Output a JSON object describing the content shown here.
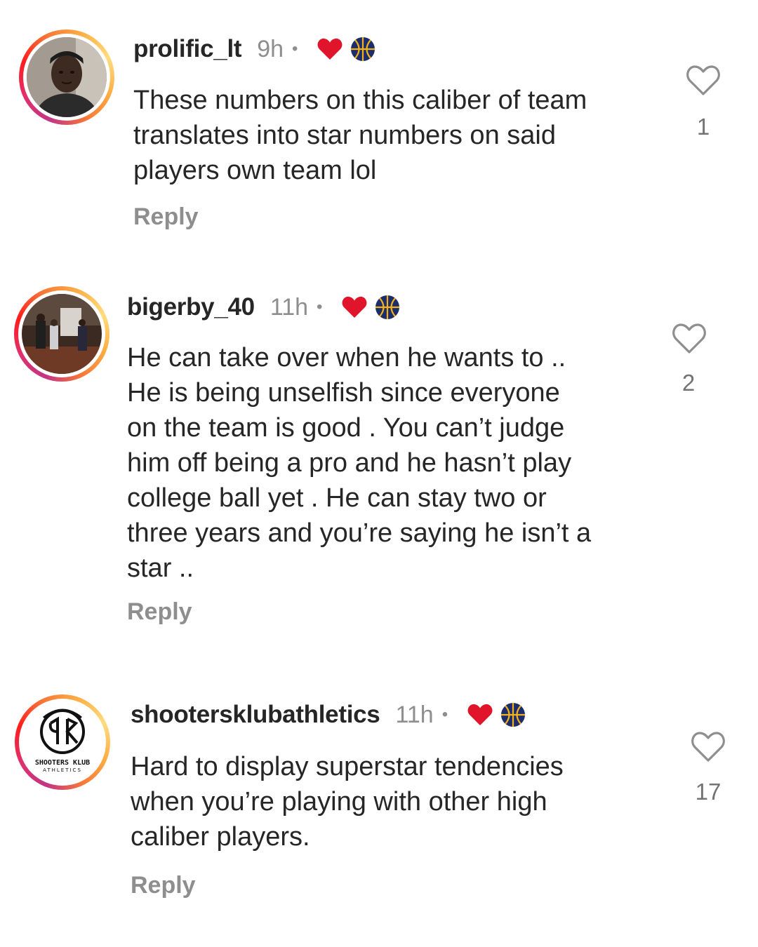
{
  "comments": [
    {
      "username": "prolific_lt",
      "time": "9h",
      "dot": "•",
      "text": "These numbers on this caliber of team\ntranslates into star numbers on said\nplayers own team lol",
      "reply_label": "Reply",
      "likes": "1",
      "avatar_icon": "person-photo"
    },
    {
      "username": "bigerby_40",
      "time": "11h",
      "dot": "•",
      "text": "He can take over when he wants to ..\nHe is being unselfish since everyone\non the team is good . You can’t judge\nhim off being a pro and he hasn’t play\ncollege ball yet . He can stay two or\nthree years and you’re saying he isn’t a\nstar ..",
      "reply_label": "Reply",
      "likes": "2",
      "avatar_icon": "gym-photo"
    },
    {
      "username": "shootersklubathletics",
      "time": "11h",
      "dot": "•",
      "text": "Hard to display superstar tendencies\nwhen you’re playing with other high\ncaliber players.",
      "reply_label": "Reply",
      "likes": "17",
      "avatar_icon": "shooters-klub-logo",
      "logo_text_main": "SHOOTERS KLUB",
      "logo_text_sub": "ATHLETICS"
    }
  ],
  "colors": {
    "heart_badge": "#e0142b",
    "ball_badge": "#1d2d6b",
    "ball_badge_accent": "#f3b21b"
  }
}
